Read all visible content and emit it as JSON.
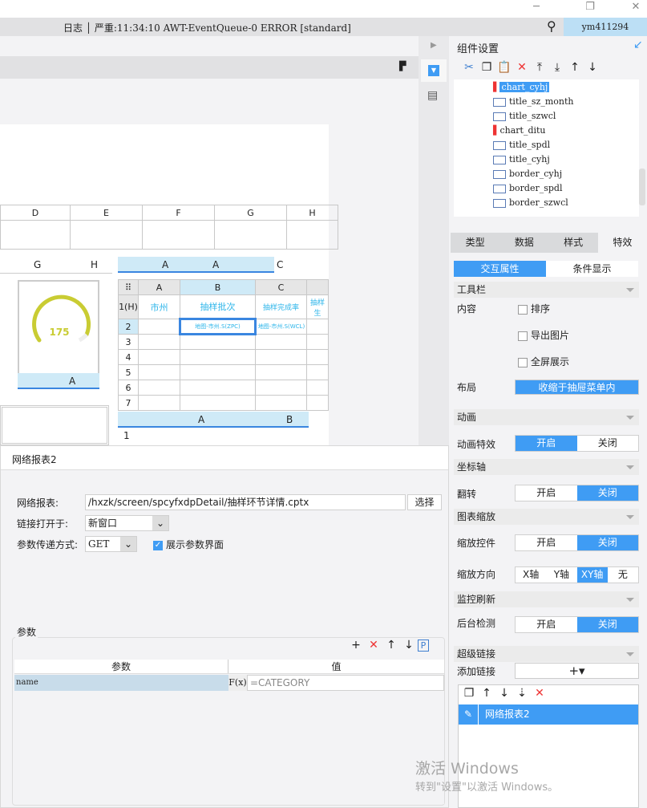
{
  "window": {
    "minimize": "─",
    "restore": "❐",
    "close": "✕"
  },
  "log": {
    "text": "日志 │ 严重:11:34:10 AWT-EventQueue-0 ERROR [standard]",
    "user": "ym411294"
  },
  "sheet": {
    "cols_top": [
      "D",
      "E",
      "F",
      "G",
      "H"
    ],
    "cols_mid": [
      "G",
      "H"
    ],
    "gauge_value": "175",
    "inner_cols": [
      "A",
      "B",
      "C"
    ],
    "inner_rows": [
      "1(H)",
      "2",
      "3",
      "4",
      "5",
      "6",
      "7"
    ],
    "inner_headers": [
      "市州",
      "抽样批次",
      "抽样完成率",
      "抽样生"
    ],
    "inner_cells": [
      "地图-市州.S(ZPC)",
      "地图-市州.S(WCL)"
    ],
    "small_cols": [
      "A",
      "A",
      "C",
      "A",
      "A",
      "B"
    ],
    "row_one": "1"
  },
  "panel": {
    "title": "组件设置",
    "tree": [
      "chart_cyhj",
      "title_sz_month",
      "title_szwcl",
      "chart_ditu",
      "title_spdl",
      "title_cyhj",
      "border_cyhj",
      "border_spdl",
      "border_szwcl"
    ],
    "tabs": [
      "类型",
      "数据",
      "样式",
      "特效"
    ],
    "subtabs": [
      "交互属性",
      "条件显示"
    ],
    "toolbar_section": "工具栏",
    "content_label": "内容",
    "checks": [
      "排序",
      "导出图片",
      "全屏展示"
    ],
    "layout_label": "布局",
    "layout_value": "收缩于抽屉菜单内",
    "anim_section": "动画",
    "anim_label": "动画特效",
    "on": "开启",
    "off": "关闭",
    "axis_section": "坐标轴",
    "flip_label": "翻转",
    "zoom_section": "图表缩放",
    "zoom_ctrl_label": "缩放控件",
    "zoom_dir_label": "缩放方向",
    "zoom_dirs": [
      "X轴",
      "Y轴",
      "XY轴",
      "无"
    ],
    "monitor_section": "监控刷新",
    "bg_label": "后台检测",
    "link_section": "超级链接",
    "add_link_label": "添加链接",
    "add_link_btn": "+▾",
    "link_item": "网络报表2"
  },
  "dialog": {
    "title": "网络报表2",
    "report_label": "网络报表:",
    "report_value": "/hxzk/screen/spcyfxdpDetail/抽样环节详情.cptx",
    "choose": "选择",
    "open_label": "链接打开于:",
    "open_value": "新窗口",
    "method_label": "参数传递方式:",
    "method_value": "GET",
    "show_params": "展示参数界面",
    "params_legend": "参数",
    "col_param": "参数",
    "col_value": "值",
    "row_name": "name",
    "row_value": "=CATEGORY",
    "fx": "F(x)"
  },
  "watermark": {
    "line1": "激活 Windows",
    "line2": "转到\"设置\"以激活 Windows。"
  }
}
